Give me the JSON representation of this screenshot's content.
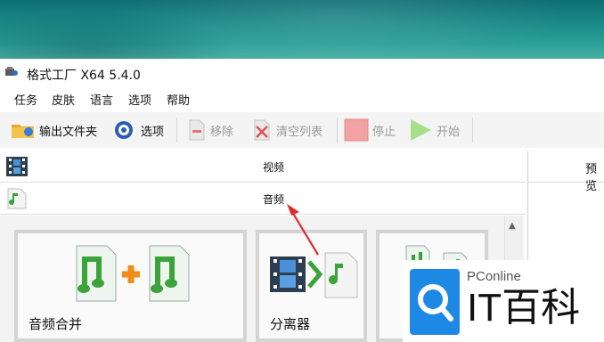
{
  "window": {
    "title": "格式工厂 X64 5.4.0"
  },
  "menu": [
    "任务",
    "皮肤",
    "语言",
    "选项",
    "帮助"
  ],
  "toolbar": {
    "output_folder": "输出文件夹",
    "options": "选项",
    "remove": "移除",
    "clear_list": "清空列表",
    "stop": "停止",
    "start": "开始"
  },
  "categories": {
    "video": "视频",
    "audio": "音频"
  },
  "tiles": {
    "audio_merge": "音频合并",
    "splitter": "分离器"
  },
  "right_panel": {
    "header": "预览"
  },
  "watermark": {
    "top": "PConline",
    "brand": "IT百科"
  },
  "colors": {
    "accent_red": "#d9302f",
    "watermark_blue": "#1e88e5"
  }
}
